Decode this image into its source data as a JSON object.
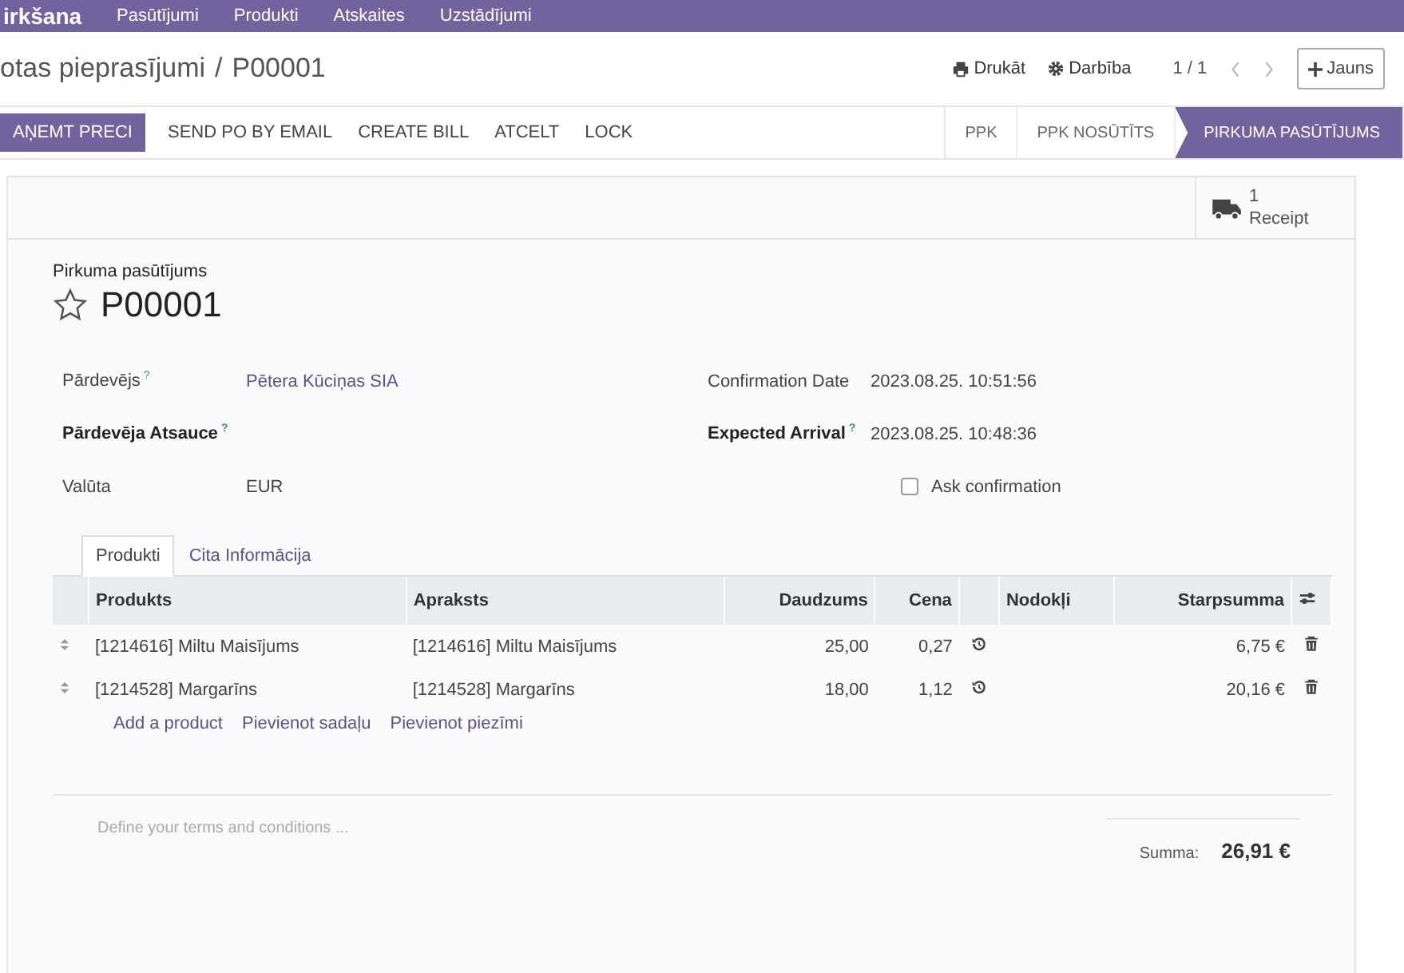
{
  "nav": {
    "app": "irkšana",
    "menu": [
      "Pasūtījumi",
      "Produkti",
      "Atskaites",
      "Uzstādījumi"
    ]
  },
  "breadcrumb": {
    "parent": "otas pieprasījumi",
    "separator": "/",
    "current": "P00001"
  },
  "toolbar": {
    "print": "Drukāt",
    "action": "Darbība",
    "pager": "1 / 1",
    "new": "Jauns"
  },
  "buttons": [
    {
      "label": "AŅEMT PRECI",
      "kind": "primary"
    },
    {
      "label": "SEND PO BY EMAIL",
      "kind": "secondary"
    },
    {
      "label": "CREATE BILL",
      "kind": "secondary"
    },
    {
      "label": "ATCELT",
      "kind": "secondary"
    },
    {
      "label": "LOCK",
      "kind": "secondary"
    }
  ],
  "statuses": [
    {
      "label": "PPK",
      "selected": false
    },
    {
      "label": "PPK NOSŪTĪTS",
      "selected": false
    },
    {
      "label": "PIRKUMA PASŪTĪJUMS",
      "selected": true
    }
  ],
  "smart_button": {
    "count": "1",
    "label": "Receipt"
  },
  "title": {
    "subtitle": "Pirkuma pasūtījums",
    "name": "P00001",
    "starred": false
  },
  "fields_left": [
    {
      "label": "Pārdevējs",
      "help": "?",
      "value": "Pētera Kūciņas SIA",
      "required": false,
      "kind": "link"
    },
    {
      "label": "Pārdevēja Atsauce",
      "help": "?",
      "required": true,
      "kind": "text"
    },
    {
      "label": "Valūta",
      "value": "EUR",
      "required": false,
      "kind": "text"
    }
  ],
  "fields_right": [
    {
      "label": "Confirmation Date",
      "value": "2023.08.25. 10:51:56",
      "required": false,
      "kind": "text"
    },
    {
      "label": "Expected Arrival",
      "help": "?",
      "value": "2023.08.25. 10:48:36",
      "required": true,
      "kind": "text"
    },
    {
      "value": "Ask confirmation",
      "checked": false,
      "kind": "checkbox"
    }
  ],
  "tabs": [
    {
      "label": "Produkti",
      "selected": true
    },
    {
      "label": "Cita Informācija",
      "selected": false
    }
  ],
  "table": {
    "columns": [
      "Produkts",
      "Apraksts",
      "Daudzums",
      "Cena",
      "Nodokļi",
      "Starpsumma"
    ],
    "rows": [
      {
        "product": "[1214616] Miltu Maisījums",
        "description": "[1214616] Miltu Maisījums",
        "quantity": "25,00",
        "price": "0,27",
        "subtotal": "6,75 €"
      },
      {
        "product": "[1214528] Margarīns",
        "description": "[1214528] Margarīns",
        "quantity": "18,00",
        "price": "1,12",
        "subtotal": "20,16 €"
      }
    ],
    "add_links": [
      "Add a product",
      "Pievienot sadaļu",
      "Pievienot piezīmi"
    ]
  },
  "terms": {
    "placeholder": "Define your terms and conditions ..."
  },
  "total": {
    "label": "Summa:",
    "value": "26,91 €"
  }
}
